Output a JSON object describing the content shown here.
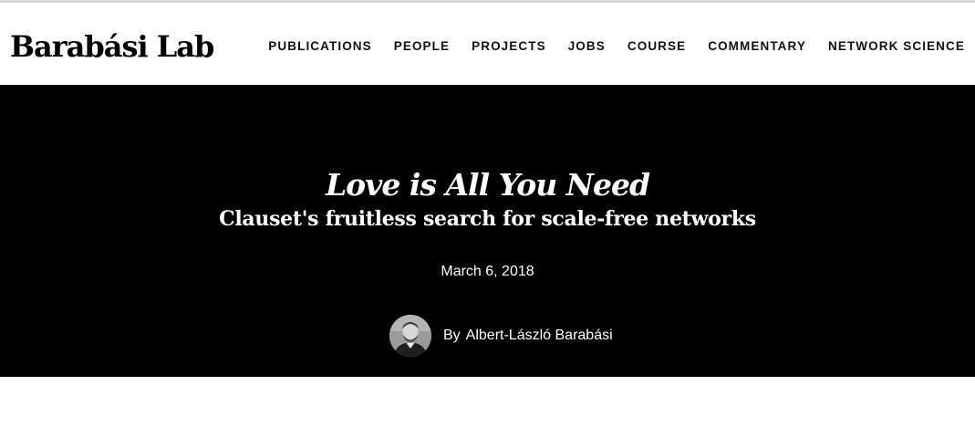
{
  "site": {
    "logo": "Barabási Lab"
  },
  "nav": {
    "items": [
      {
        "label": "PUBLICATIONS"
      },
      {
        "label": "PEOPLE"
      },
      {
        "label": "PROJECTS"
      },
      {
        "label": "JOBS"
      },
      {
        "label": "COURSE"
      },
      {
        "label": "COMMENTARY"
      },
      {
        "label": "NETWORK SCIENCE"
      }
    ]
  },
  "article": {
    "title": "Love is All You Need",
    "subtitle": "Clauset's fruitless search for scale-free networks",
    "date": "March 6, 2018",
    "by_label": "By",
    "author": "Albert-László Barabási"
  },
  "colors": {
    "hero_background": "#000000",
    "header_background": "#ffffff",
    "text_on_dark": "#ffffff",
    "text_on_light": "#111111"
  }
}
